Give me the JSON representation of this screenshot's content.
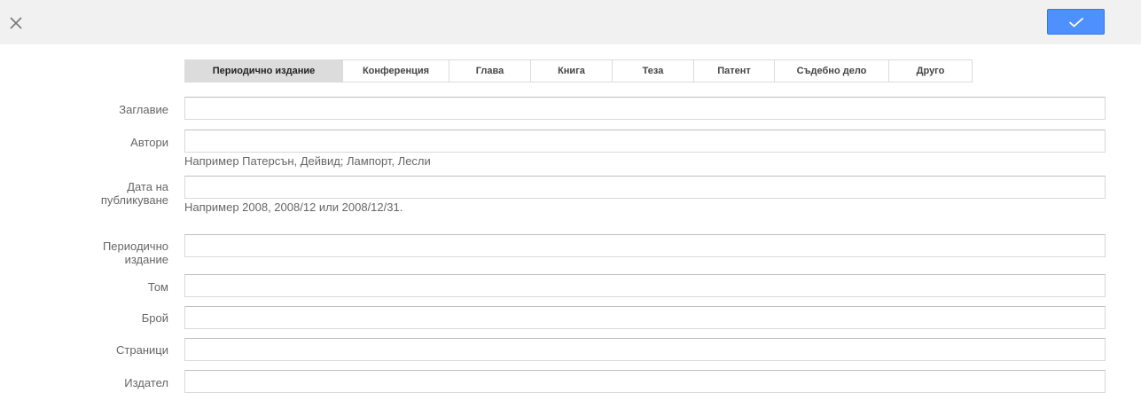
{
  "header": {
    "close_icon": "close-icon",
    "save_icon": "checkmark-icon",
    "colors": {
      "bar": "#f1f1f1",
      "save_button": "#4d90fe"
    }
  },
  "tabs": [
    {
      "label": "Периодично издание",
      "active": true
    },
    {
      "label": "Конференция",
      "active": false
    },
    {
      "label": "Глава",
      "active": false
    },
    {
      "label": "Книга",
      "active": false
    },
    {
      "label": "Теза",
      "active": false
    },
    {
      "label": "Патент",
      "active": false
    },
    {
      "label": "Съдебно дело",
      "active": false
    },
    {
      "label": "Друго",
      "active": false
    }
  ],
  "form": {
    "title": {
      "label": "Заглавие",
      "value": ""
    },
    "authors": {
      "label": "Автори",
      "value": "",
      "hint": "Например Патерсън, Дейвид; Лампорт, Лесли"
    },
    "pub_date": {
      "label_line1": "Дата на",
      "label_line2": "публикуване",
      "value": "",
      "hint": "Например 2008, 2008/12 или 2008/12/31."
    },
    "journal": {
      "label_line1": "Периодично",
      "label_line2": "издание",
      "value": ""
    },
    "volume": {
      "label": "Том",
      "value": ""
    },
    "issue": {
      "label": "Брой",
      "value": ""
    },
    "pages": {
      "label": "Страници",
      "value": ""
    },
    "publisher": {
      "label": "Издател",
      "value": ""
    }
  }
}
